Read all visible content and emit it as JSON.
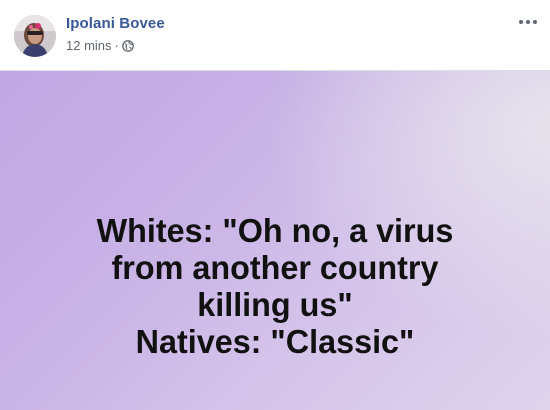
{
  "post": {
    "author_name": "Ipolani Bovee",
    "timestamp": "12 mins",
    "separator": "·",
    "privacy_icon": "globe-icon",
    "more_icon": "more-options-icon",
    "link_color": "#385898",
    "meta_color": "#616770"
  },
  "image": {
    "lines": [
      "Whites: \"Oh no, a virus",
      "from another country",
      "killing us\"",
      "Natives: \"Classic\""
    ],
    "background_colors": [
      "#c1a8e4",
      "#dfd4ec"
    ],
    "text_color": "#111111"
  }
}
